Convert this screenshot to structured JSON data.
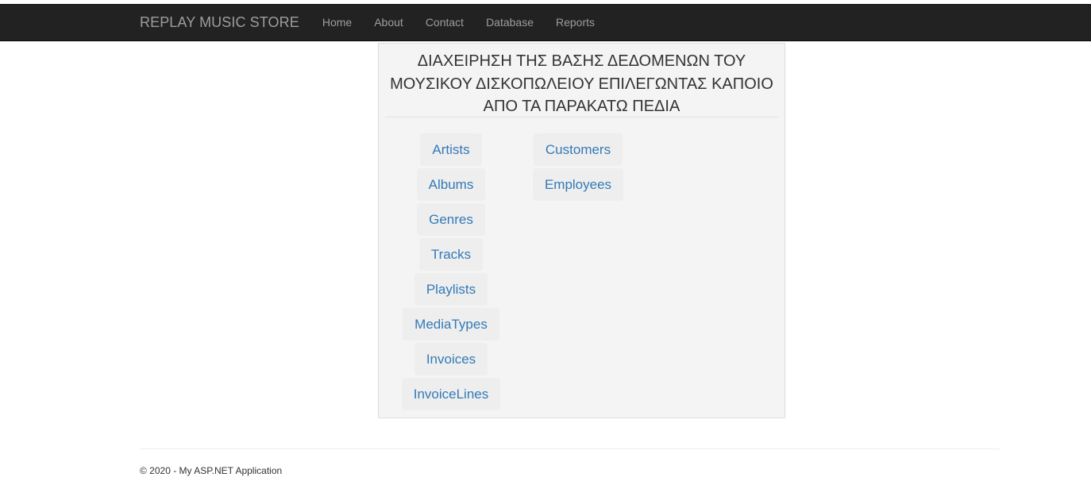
{
  "navbar": {
    "brand": "REPLAY MUSIC STORE",
    "links": [
      "Home",
      "About",
      "Contact",
      "Database",
      "Reports"
    ]
  },
  "panel": {
    "title": "ΔΙΑΧΕΙΡΗΣΗ ΤΗΣ ΒΑΣΗΣ ΔΕΔΟΜΕΝΩΝ ΤΟΥ ΜΟΥΣΙΚΟΥ ΔΙΣΚΟΠΩΛΕΙΟΥ ΕΠΙΛΕΓΩΝΤΑΣ ΚΑΠΟΙΟ ΑΠΟ ΤΑ ΠΑΡΑΚΑΤΩ ΠΕΔΙΑ",
    "left_links": [
      "Artists",
      "Albums",
      "Genres",
      "Tracks",
      "Playlists",
      "MediaTypes",
      "Invoices",
      "InvoiceLines"
    ],
    "right_links": [
      "Customers",
      "Employees"
    ]
  },
  "footer": {
    "text": "© 2020 - My ASP.NET Application"
  },
  "colors": {
    "navbar_bg": "#222222",
    "nav_text": "#9d9d9d",
    "link": "#337ab7",
    "panel_bg": "#f4f4f4",
    "button_bg": "#eeeeee"
  }
}
